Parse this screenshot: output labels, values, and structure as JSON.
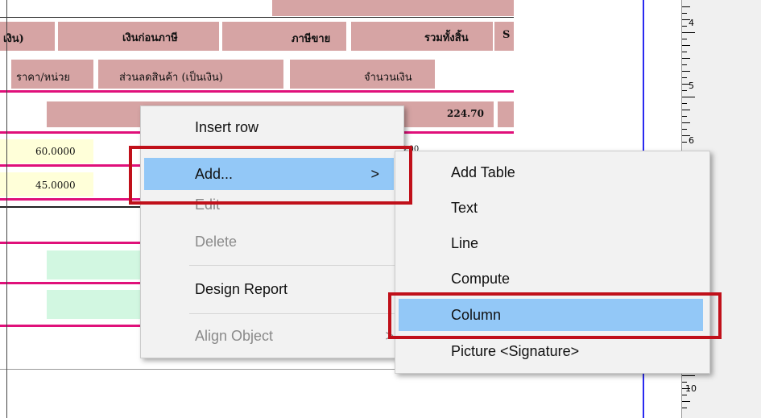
{
  "report": {
    "header_row1": [
      "เงิน)",
      "เงินก่อนภาษี",
      "ภาษีขาย",
      "รวมทั้งสิ้น",
      "S"
    ],
    "header_row2": [
      "ราคา/หน่วย",
      "ส่วนลดสินค้า (เป็นเงิน)",
      "จำนวนเงิน"
    ],
    "total_value": "224.70",
    "row_values": [
      "60.0000",
      "45.0000"
    ],
    "partial_value": "0.00"
  },
  "ruler": {
    "labels": [
      "4",
      "5",
      "6",
      "10"
    ]
  },
  "context_menu": {
    "items": [
      {
        "label": "Insert row",
        "enabled": true
      },
      {
        "label": "Add...",
        "enabled": true,
        "has_submenu": true,
        "highlighted": true
      },
      {
        "label": "Edit",
        "enabled": false
      },
      {
        "label": "Delete",
        "enabled": false
      },
      {
        "label": "Design Report",
        "enabled": true
      },
      {
        "label": "Align Object",
        "enabled": false,
        "has_submenu": true
      }
    ],
    "arrow": ">"
  },
  "submenu": {
    "items": [
      {
        "label": "Add Table"
      },
      {
        "label": "Text"
      },
      {
        "label": "Line"
      },
      {
        "label": "Compute"
      },
      {
        "label": "Column",
        "highlighted": true
      },
      {
        "label": "Picture <Signature>"
      }
    ]
  },
  "colors": {
    "highlight": "#93c8f7",
    "callout": "#c0101a",
    "field_band": "#d6a4a4",
    "band_line": "#e0107a"
  }
}
